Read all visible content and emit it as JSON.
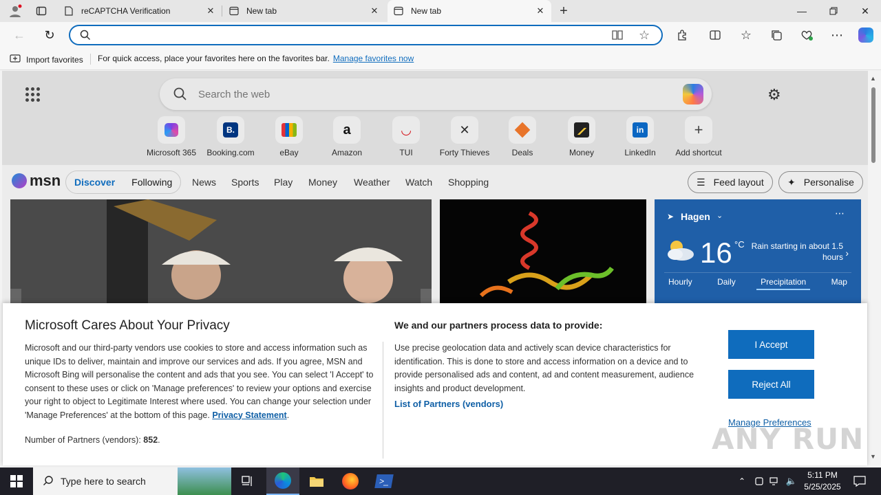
{
  "browser": {
    "tabs": [
      {
        "label": "reCAPTCHA Verification"
      },
      {
        "label": "New tab"
      },
      {
        "label": "New tab"
      }
    ],
    "address_placeholder": ""
  },
  "favorites_bar": {
    "import_label": "Import favorites",
    "hint": "For quick access, place your favorites here on the favorites bar.",
    "manage_link": "Manage favorites now"
  },
  "newtab": {
    "search_placeholder": "Search the web",
    "shortcuts": [
      {
        "label": "Microsoft 365",
        "icon": "m365-icon"
      },
      {
        "label": "Booking.com",
        "icon": "booking-icon"
      },
      {
        "label": "eBay",
        "icon": "ebay-icon"
      },
      {
        "label": "Amazon",
        "icon": "amazon-icon"
      },
      {
        "label": "TUI",
        "icon": "tui-icon"
      },
      {
        "label": "Forty Thieves",
        "icon": "swords-icon"
      },
      {
        "label": "Deals",
        "icon": "deals-icon"
      },
      {
        "label": "Money",
        "icon": "money-icon"
      },
      {
        "label": "LinkedIn",
        "icon": "linkedin-icon"
      },
      {
        "label": "Add shortcut",
        "icon": "plus-icon"
      }
    ],
    "msn": {
      "logo": "msn",
      "discover": "Discover",
      "following": "Following",
      "nav": [
        "News",
        "Sports",
        "Play",
        "Money",
        "Weather",
        "Watch",
        "Shopping"
      ],
      "feed_layout": "Feed layout",
      "personalise": "Personalise"
    },
    "weather": {
      "location": "Hagen",
      "temperature": "16",
      "unit": "°C",
      "condition": "Rain starting in about 1.5 hours",
      "tabs": [
        "Hourly",
        "Daily",
        "Precipitation",
        "Map"
      ],
      "selected_tab": "Precipitation"
    }
  },
  "privacy": {
    "title": "Microsoft Cares About Your Privacy",
    "body": "Microsoft and our third-party vendors use cookies to store and access information such as unique IDs to deliver, maintain and improve our services and ads. If you agree, MSN and Microsoft Bing will personalise the content and ads that you see. You can select 'I Accept' to consent to these uses or click on 'Manage preferences' to review your options and exercise your right to object to Legitimate Interest where used.  You can change your selection under 'Manage Preferences' at the bottom of this page.",
    "privacy_link": "Privacy Statement",
    "partners_label": "Number of Partners (vendors):",
    "partners_count": "852",
    "process_title": "We and our partners process data to provide:",
    "process_body": "Use precise geolocation data and actively scan device characteristics for identification. This is done to store and access information on a device and to provide personalised ads and content, ad and content measurement, audience insights and product development.",
    "partners_link": "List of Partners (vendors)",
    "accept": "I Accept",
    "reject": "Reject All",
    "manage": "Manage Preferences"
  },
  "watermark": "ANY RUN",
  "taskbar": {
    "search_placeholder": "Type here to search",
    "time": "5:11 PM",
    "date": "5/25/2025"
  },
  "colors": {
    "accent": "#0f6cbd",
    "taskbar": "#1f1f27",
    "weather_card": "#1f5fa8"
  }
}
